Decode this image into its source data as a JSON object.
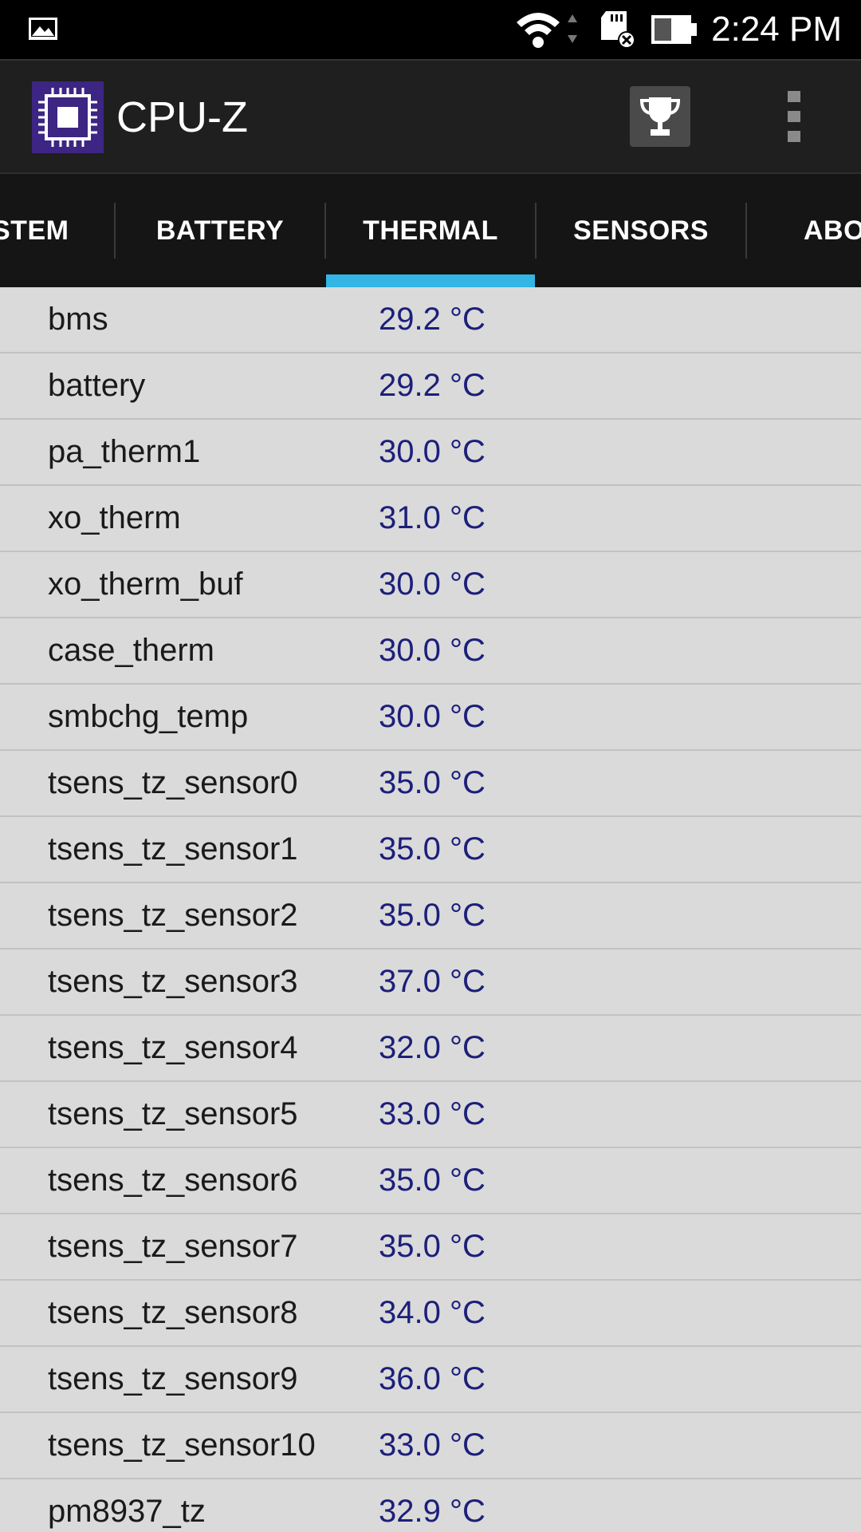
{
  "status_bar": {
    "time": "2:24 PM",
    "icons": [
      "gallery-icon",
      "wifi-icon",
      "sd-card-error-icon",
      "battery-icon"
    ]
  },
  "app_bar": {
    "title": "CPU-Z",
    "logo_icon": "cpu-chip-icon",
    "actions": [
      "trophy-icon",
      "overflow-menu-icon"
    ]
  },
  "tabs": [
    {
      "label": "STEM",
      "selected": false
    },
    {
      "label": "BATTERY",
      "selected": false
    },
    {
      "label": "THERMAL",
      "selected": true
    },
    {
      "label": "SENSORS",
      "selected": false
    },
    {
      "label": "ABO",
      "selected": false
    }
  ],
  "colors": {
    "accent": "#33b5e5",
    "value_text": "#1c1f7a",
    "list_background": "#dadada",
    "app_bar": "#1f1f1f",
    "tab_strip": "#151515"
  },
  "sensors": [
    {
      "name": "bms",
      "value": "29.2 °C"
    },
    {
      "name": "battery",
      "value": "29.2 °C"
    },
    {
      "name": "pa_therm1",
      "value": "30.0 °C"
    },
    {
      "name": "xo_therm",
      "value": "31.0 °C"
    },
    {
      "name": "xo_therm_buf",
      "value": "30.0 °C"
    },
    {
      "name": "case_therm",
      "value": "30.0 °C"
    },
    {
      "name": "smbchg_temp",
      "value": "30.0 °C"
    },
    {
      "name": "tsens_tz_sensor0",
      "value": "35.0 °C"
    },
    {
      "name": "tsens_tz_sensor1",
      "value": "35.0 °C"
    },
    {
      "name": "tsens_tz_sensor2",
      "value": "35.0 °C"
    },
    {
      "name": "tsens_tz_sensor3",
      "value": "37.0 °C"
    },
    {
      "name": "tsens_tz_sensor4",
      "value": "32.0 °C"
    },
    {
      "name": "tsens_tz_sensor5",
      "value": "33.0 °C"
    },
    {
      "name": "tsens_tz_sensor6",
      "value": "35.0 °C"
    },
    {
      "name": "tsens_tz_sensor7",
      "value": "35.0 °C"
    },
    {
      "name": "tsens_tz_sensor8",
      "value": "34.0 °C"
    },
    {
      "name": "tsens_tz_sensor9",
      "value": "36.0 °C"
    },
    {
      "name": "tsens_tz_sensor10",
      "value": "33.0 °C"
    },
    {
      "name": "pm8937_tz",
      "value": "32.9 °C"
    }
  ]
}
